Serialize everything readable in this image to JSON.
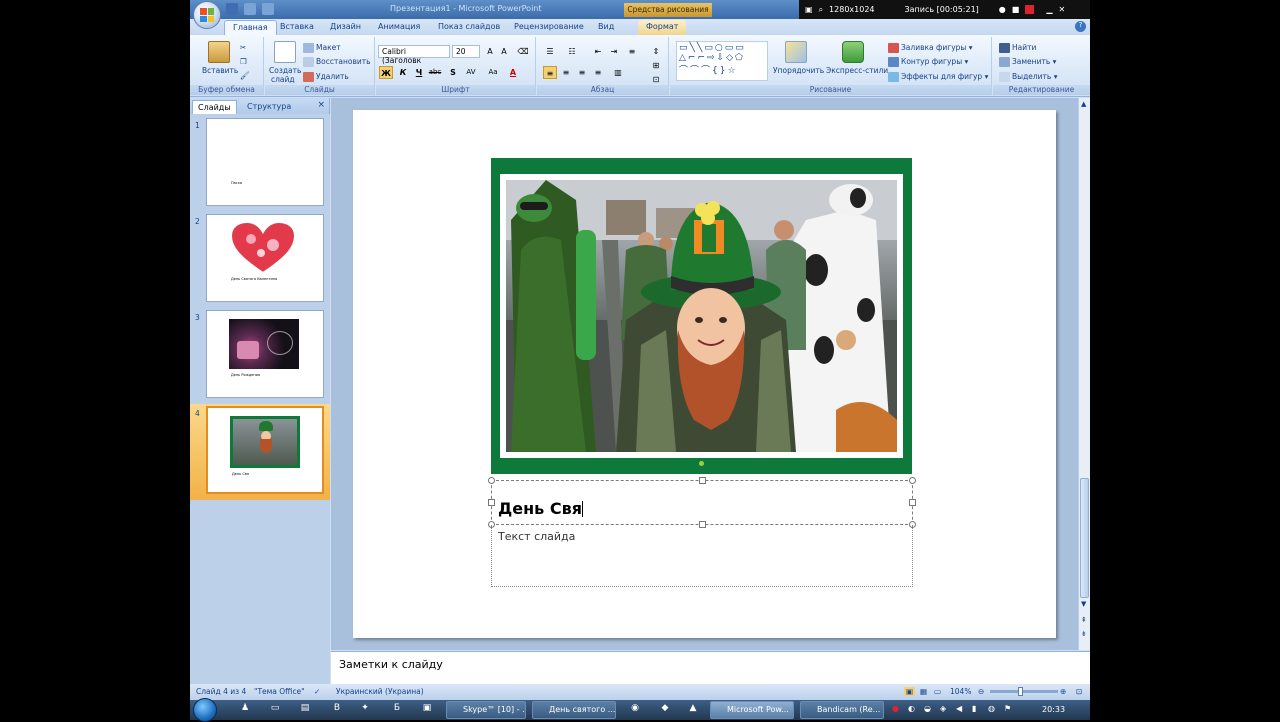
{
  "window": {
    "title": "Презентация1 - Microsoft PowerPoint",
    "context_tab_group": "Средства рисования"
  },
  "recorder": {
    "resolution": "1280x1024",
    "record_label": "Запись [00:05:21]"
  },
  "tabs": [
    {
      "label": "Главная",
      "active": true
    },
    {
      "label": "Вставка"
    },
    {
      "label": "Дизайн"
    },
    {
      "label": "Анимация"
    },
    {
      "label": "Показ слайдов"
    },
    {
      "label": "Рецензирование"
    },
    {
      "label": "Вид"
    },
    {
      "label": "Формат",
      "contextual": true
    }
  ],
  "ribbon": {
    "clipboard": {
      "paste": "Вставить",
      "label": "Буфер обмена"
    },
    "slides": {
      "new_slide_1": "Создать",
      "new_slide_2": "слайд",
      "layout": "Макет",
      "reset": "Восстановить",
      "delete": "Удалить",
      "label": "Слайды"
    },
    "font": {
      "name": "Calibri (Заголовк",
      "size": "20",
      "bold": "Ж",
      "italic": "К",
      "underline": "Ч",
      "strike": "abc",
      "shadow": "S",
      "spacing": "AV",
      "case": "Aa",
      "color": "A",
      "label": "Шрифт"
    },
    "paragraph": {
      "label": "Абзац"
    },
    "drawing": {
      "arrange": "Упорядочить",
      "quick_styles": "Экспресс-стили",
      "fill": "Заливка фигуры",
      "outline": "Контур фигуры",
      "effects": "Эффекты для фигур",
      "label": "Рисование"
    },
    "editing": {
      "find": "Найти",
      "replace": "Заменить",
      "select": "Выделить",
      "label": "Редактирование"
    }
  },
  "left_panel": {
    "tab_slides": "Слайды",
    "tab_outline": "Структура",
    "thumbnails": [
      {
        "number": "1",
        "caption": "Пасха"
      },
      {
        "number": "2",
        "caption": "День Святого Валентина"
      },
      {
        "number": "3",
        "caption": "День Рождения"
      },
      {
        "number": "4",
        "caption": "День Свя",
        "selected": true
      }
    ]
  },
  "slide": {
    "title": "День Свя",
    "body_placeholder": "Текст слайда"
  },
  "notes": {
    "placeholder": "Заметки к слайду"
  },
  "status": {
    "slide_of": "Слайд 4 из 4",
    "theme": "\"Тема Office\"",
    "language": "Украинский (Украина)",
    "zoom": "104%"
  },
  "taskbar": {
    "tasks": [
      {
        "label": "Skype™ [10] - ..."
      },
      {
        "label": "День святого ..."
      },
      {
        "label": "Microsoft Pow...",
        "active": true
      },
      {
        "label": "Bandicam (Re..."
      }
    ],
    "clock": "20:33"
  },
  "colors": {
    "frame_green": "#0d7a3c",
    "ribbon_blue": "#15428b",
    "selection_orange": "#f2b247"
  }
}
